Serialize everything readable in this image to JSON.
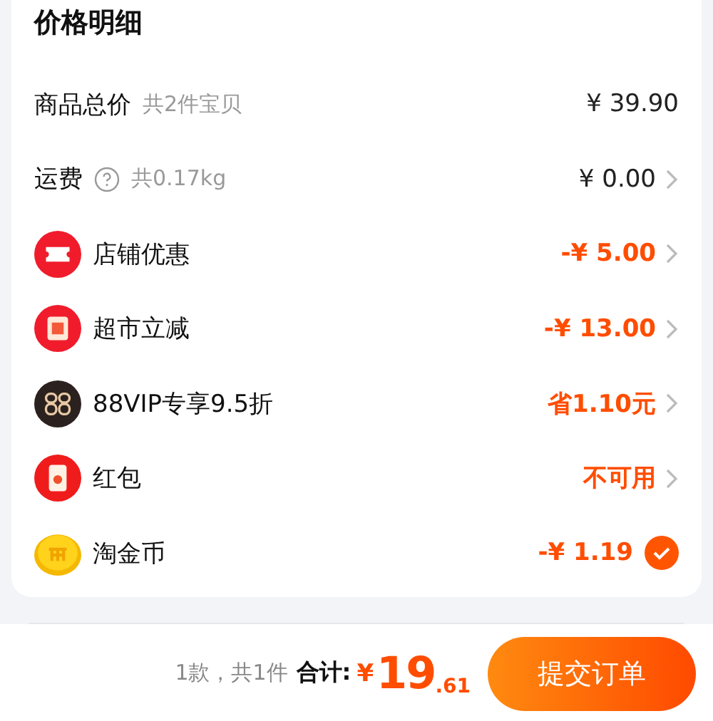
{
  "title": "价格明细",
  "rows": [
    {
      "kind": "total",
      "label": "商品总价",
      "note": "共2件宝贝",
      "value": "¥ 39.90",
      "emphasis": false,
      "arrow": false
    },
    {
      "kind": "shipping",
      "label": "运费",
      "note": "共0.17kg",
      "value": "¥ 0.00",
      "emphasis": false,
      "arrow": true
    },
    {
      "kind": "ticket",
      "label": "店铺优惠",
      "value": "-¥ 5.00",
      "emphasis": true,
      "arrow": true
    },
    {
      "kind": "reduce",
      "label": "超市立减",
      "value": "-¥ 13.00",
      "emphasis": true,
      "arrow": true
    },
    {
      "kind": "vip",
      "label": "88VIP专享9.5折",
      "value": "省1.10元",
      "emphasis": true,
      "arrow": true
    },
    {
      "kind": "envelope",
      "label": "红包",
      "value": "不可用",
      "emphasis": true,
      "arrow": true
    },
    {
      "kind": "coin",
      "label": "淘金币",
      "value": "-¥ 1.19",
      "emphasis": true,
      "arrow": false,
      "checked": true
    }
  ],
  "footer": {
    "count": "1款，共1件",
    "total_label": "合计:",
    "currency": "¥",
    "total_int": "19",
    "total_dec": ".61",
    "submit": "提交订单"
  }
}
